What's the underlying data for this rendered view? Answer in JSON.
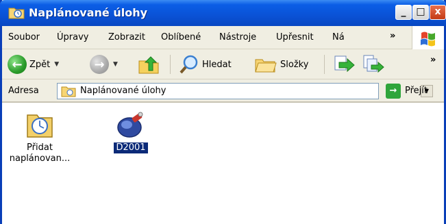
{
  "window": {
    "title": "Naplánované úlohy",
    "controls": {
      "minimize": "_",
      "maximize": "□",
      "close": "x"
    }
  },
  "menubar": {
    "items": [
      "Soubor",
      "Úpravy",
      "Zobrazit",
      "Oblíbené",
      "Nástroje",
      "Upřesnit",
      "Ná"
    ],
    "overflow": "»"
  },
  "toolbar": {
    "back": "Zpět",
    "search": "Hledat",
    "folders": "Složky",
    "overflow": "»"
  },
  "address": {
    "label": "Adresa",
    "value": "Naplánované úlohy",
    "go": "Přejít"
  },
  "items": [
    {
      "label1": "Přidat",
      "label2": "naplánovan..."
    },
    {
      "label": "D2001"
    }
  ]
}
